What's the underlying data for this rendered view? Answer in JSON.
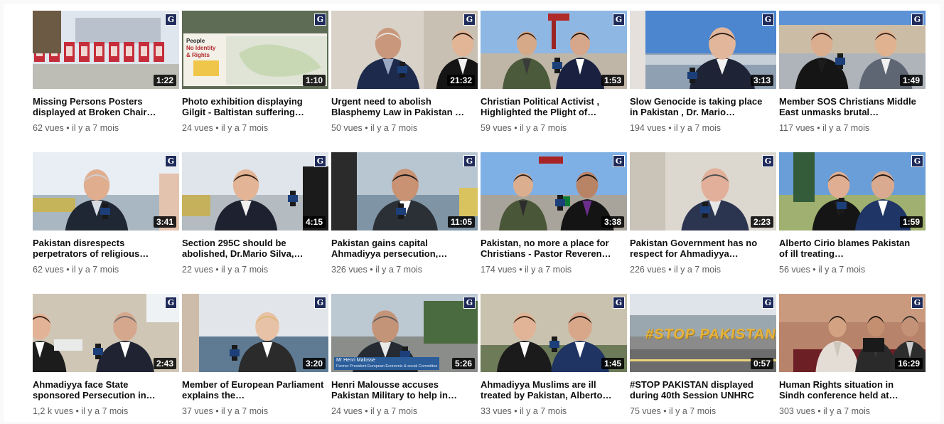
{
  "colors": {
    "background": "#f9f9f9",
    "title": "#0f0f0f",
    "meta": "#606060",
    "channel_logo": "#1f2b5a"
  },
  "channel_logo_glyph": "G",
  "videos": [
    {
      "title": "Missing Persons Posters displayed at Broken Chair…",
      "duration": "1:22",
      "views": "62 vues",
      "age": "il y a 7 mois",
      "thumb": "posters"
    },
    {
      "title": "Photo exhibition displaying Gilgit - Baltistan suffering…",
      "duration": "1:10",
      "views": "24 vues",
      "age": "il y a 7 mois",
      "thumb": "map",
      "thumb_text": [
        "People",
        "No Identity",
        "& Rights"
      ]
    },
    {
      "title": "Urgent need to abolish Blasphemy Law in Pakistan …",
      "duration": "21:32",
      "views": "50 vues",
      "age": "il y a 7 mois",
      "thumb": "indoor"
    },
    {
      "title": "Christian Political Activist , Highlighted the Plight of…",
      "duration": "1:53",
      "views": "59 vues",
      "age": "il y a 7 mois",
      "thumb": "square"
    },
    {
      "title": "Slow Genocide is taking place in Pakistan , Dr. Mario…",
      "duration": "3:13",
      "views": "194 vues",
      "age": "il y a 7 mois",
      "thumb": "sky"
    },
    {
      "title": "Member SOS Christians Middle East unmasks brutal…",
      "duration": "1:49",
      "views": "117 vues",
      "age": "il y a 7 mois",
      "thumb": "square2"
    },
    {
      "title": "Pakistan disrespects perpetrators of religious…",
      "duration": "3:41",
      "views": "62 vues",
      "age": "il y a 7 mois",
      "thumb": "lake"
    },
    {
      "title": "Section 295C should be abolished, Dr.Mario Silva,…",
      "duration": "4:15",
      "views": "22 vues",
      "age": "il y a 7 mois",
      "thumb": "lake2"
    },
    {
      "title": "Pakistan gains capital Ahmadiyya persecution,…",
      "duration": "11:05",
      "views": "326 vues",
      "age": "il y a 7 mois",
      "thumb": "lake3"
    },
    {
      "title": "Pakistan, no more a place for Christians - Pastor Reveren…",
      "duration": "3:38",
      "views": "174 vues",
      "age": "il y a 7 mois",
      "thumb": "square3"
    },
    {
      "title": "Pakistan Government has no respect for Ahmadiyya…",
      "duration": "2:23",
      "views": "226 vues",
      "age": "il y a 7 mois",
      "thumb": "building"
    },
    {
      "title": "Alberto Cirio blames Pakistan of ill treating…",
      "duration": "1:59",
      "views": "56 vues",
      "age": "il y a 7 mois",
      "thumb": "square4"
    },
    {
      "title": "Ahmadiyya face State sponsored Persecution in…",
      "duration": "2:43",
      "views": "1,2 k vues",
      "age": "il y a 7 mois",
      "thumb": "palace"
    },
    {
      "title": "Member of European Parliament explains the…",
      "duration": "3:20",
      "views": "37 vues",
      "age": "il y a 7 mois",
      "thumb": "lake4"
    },
    {
      "title": "Henri Malousse accuses Pakistan Military to help in…",
      "duration": "5:26",
      "views": "24 vues",
      "age": "il y a 7 mois",
      "thumb": "city",
      "caption": "Mr Henri Malosse",
      "caption_sub": "Former President European Economic & social Committee"
    },
    {
      "title": "Ahmadiyya Muslims are ill treated by Pakistan, Alberto…",
      "duration": "1:45",
      "views": "33 vues",
      "age": "il y a 7 mois",
      "thumb": "palace2"
    },
    {
      "title": "#STOP PAKISTAN displayed during 40th Session UNHRC",
      "duration": "0:57",
      "views": "75 vues",
      "age": "il y a 7 mois",
      "thumb": "stop",
      "thumb_text": [
        "#STOP PAKISTAN"
      ]
    },
    {
      "title": "Human Rights situation in Sindh conference held at…",
      "duration": "16:29",
      "views": "303 vues",
      "age": "il y a 7 mois",
      "thumb": "conference"
    }
  ]
}
